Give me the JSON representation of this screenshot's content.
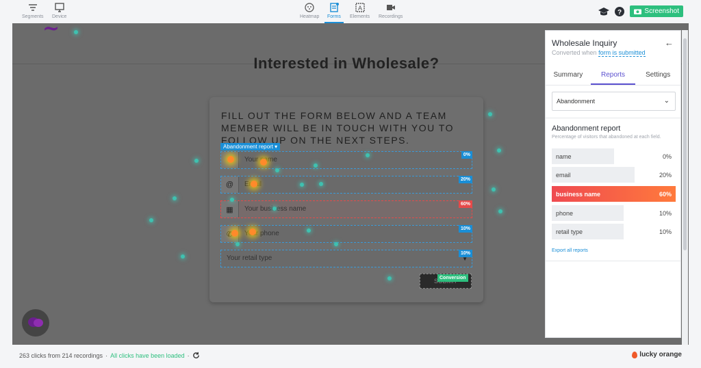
{
  "toolbar": {
    "left": [
      {
        "label": "Segments",
        "icon": "filter-lines-icon"
      },
      {
        "label": "Device",
        "icon": "monitor-icon"
      }
    ],
    "center": [
      {
        "label": "Heatmap",
        "icon": "heatmap-icon"
      },
      {
        "label": "Forms",
        "icon": "forms-icon",
        "active": true
      },
      {
        "label": "Elements",
        "icon": "elements-icon"
      },
      {
        "label": "Recordings",
        "icon": "camera-icon"
      }
    ],
    "screenshot_label": "Screenshot"
  },
  "site": {
    "heading": "Interested in Wholesale?",
    "form_intro": "FILL OUT THE FORM BELOW AND A TEAM MEMBER WILL BE IN TOUCH WITH YOU TO FOLLOW UP ON THE NEXT STEPS.",
    "abandonment_tag": "Abandonment report ▾",
    "fields": [
      {
        "placeholder": "Your name",
        "percent": "0%",
        "icon": "person-icon"
      },
      {
        "placeholder": "Email",
        "percent": "20%",
        "icon": "at-icon"
      },
      {
        "placeholder": "Your business name",
        "percent": "60%",
        "icon": "building-icon"
      },
      {
        "placeholder": "Your phone",
        "percent": "10%",
        "icon": "phone-icon"
      },
      {
        "placeholder": "Your retail type",
        "percent": "10%"
      }
    ],
    "submit_label": "SUBMIT",
    "conversion_tag": "Conversion"
  },
  "panel": {
    "title": "Wholesale Inquiry",
    "subtitle_prefix": "Converted when",
    "subtitle_link": "form is submitted",
    "tabs": [
      "Summary",
      "Reports",
      "Settings"
    ],
    "active_tab": "Reports",
    "dropdown_value": "Abandonment",
    "report_title": "Abandonment report",
    "report_subtitle": "Percentage of visitors that abandoned at each field.",
    "rows": [
      {
        "label": "name",
        "value": "0%",
        "fraction": 0.5
      },
      {
        "label": "email",
        "value": "20%",
        "fraction": 0.67
      },
      {
        "label": "business name",
        "value": "60%",
        "fraction": 1.0,
        "highlight": true
      },
      {
        "label": "phone",
        "value": "10%",
        "fraction": 0.58
      },
      {
        "label": "retail type",
        "value": "10%",
        "fraction": 0.58
      }
    ],
    "export_label": "Export all reports"
  },
  "status": {
    "clicks": "263 clicks from 214 recordings",
    "separator": "·",
    "loaded": "All clicks have been loaded",
    "separator2": "·"
  },
  "brand": "lucky orange",
  "colors": {
    "accent_blue": "#1a8ed6",
    "accent_green": "#2dbf7e",
    "hot_red": "#e64a4a",
    "tab_purple": "#5a4fcf"
  }
}
